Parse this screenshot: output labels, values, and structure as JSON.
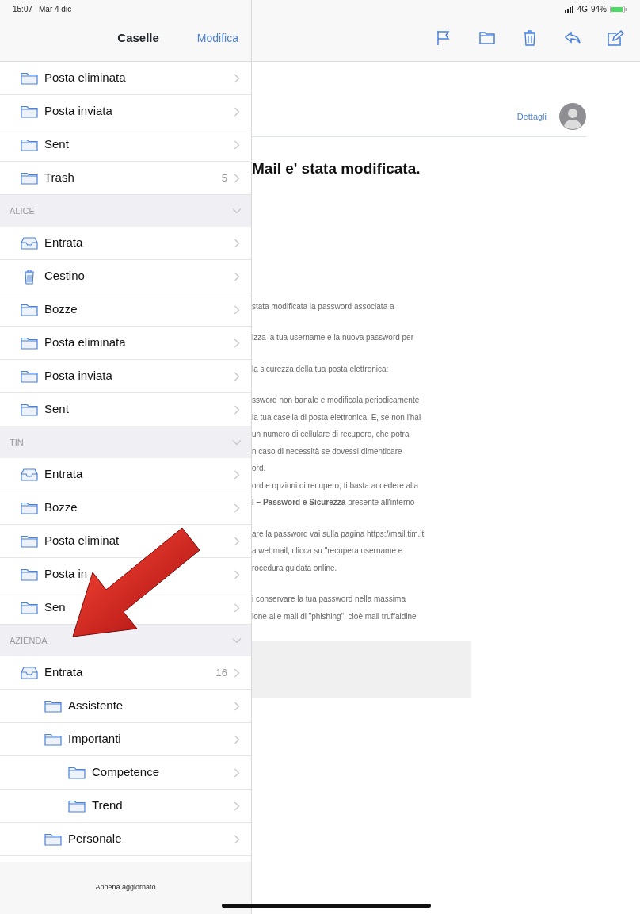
{
  "status_bar": {
    "time": "15:07",
    "date": "Mar 4 dic",
    "network": "4G",
    "battery": "94%"
  },
  "sidebar": {
    "title": "Caselle",
    "edit": "Modifica",
    "sections": [
      {
        "items": [
          {
            "label": "Posta eliminata",
            "kind": "folder"
          },
          {
            "label": "Posta inviata",
            "kind": "folder"
          },
          {
            "label": "Sent",
            "kind": "folder"
          },
          {
            "label": "Trash",
            "kind": "folder",
            "count": "5"
          }
        ]
      },
      {
        "name": "ALICE",
        "expanded": true,
        "items": [
          {
            "label": "Entrata",
            "kind": "inbox"
          },
          {
            "label": "Cestino",
            "kind": "trash"
          },
          {
            "label": "Bozze",
            "kind": "folder"
          },
          {
            "label": "Posta eliminata",
            "kind": "folder"
          },
          {
            "label": "Posta inviata",
            "kind": "folder"
          },
          {
            "label": "Sent",
            "kind": "folder"
          }
        ]
      },
      {
        "name": "TIN",
        "expanded": true,
        "items": [
          {
            "label": "Entrata",
            "kind": "inbox"
          },
          {
            "label": "Bozze",
            "kind": "folder"
          },
          {
            "label": "Posta eliminat",
            "kind": "folder"
          },
          {
            "label": "Posta in",
            "kind": "folder"
          },
          {
            "label": "Sen",
            "kind": "folder"
          }
        ]
      },
      {
        "name": "AZIENDA",
        "expanded": true,
        "items": [
          {
            "label": "Entrata",
            "kind": "inbox",
            "count": "16",
            "children": [
              {
                "label": "Assistente",
                "kind": "folder"
              },
              {
                "label": "Importanti",
                "kind": "folder",
                "children": [
                  {
                    "label": "Competence",
                    "kind": "folder"
                  },
                  {
                    "label": "Trend",
                    "kind": "folder"
                  }
                ]
              },
              {
                "label": "Personale",
                "kind": "folder"
              }
            ]
          }
        ]
      }
    ],
    "footer": "Appena aggiornato"
  },
  "message": {
    "details_link": "Dettagli",
    "subject": "Mail e' stata modificata.",
    "paragraphs": [
      [
        "stata modificata la password associata a"
      ],
      [
        "izza la tua username e la nuova password per"
      ],
      [
        "la sicurezza della tua posta elettronica:"
      ],
      [
        "ssword non banale e modificala periodicamente",
        "la tua casella di posta elettronica. E, se non l'hai",
        "un numero di cellulare di recupero, che potrai",
        "n caso di necessità se dovessi dimenticare",
        "ord.",
        "ord e opzioni di recupero, ti basta accedere alla",
        "**l – Password e Sicurezza** presente all'interno"
      ],
      [
        "are la password vai sulla pagina https://mail.tim.it",
        "a webmail, clicca su \"recupera username e",
        "rocedura guidata online."
      ],
      [
        "i conservare la tua password nella massima",
        "ione alle mail di \"phishing\", cioè mail truffaldine"
      ]
    ]
  }
}
